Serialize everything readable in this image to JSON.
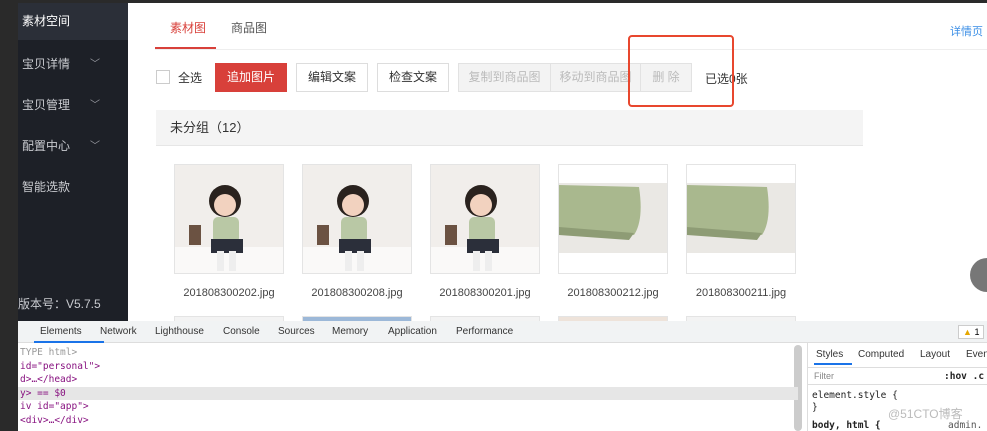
{
  "sidebar": {
    "items": [
      {
        "label": "素材空间",
        "active": true
      },
      {
        "label": "宝贝详情",
        "chevron": "chevron-down-icon"
      },
      {
        "label": "宝贝管理",
        "chevron": "chevron-down-icon"
      },
      {
        "label": "配置中心",
        "chevron": "chevron-down-icon"
      },
      {
        "label": "智能选款"
      }
    ],
    "version": "版本号：V5.7.5"
  },
  "tabs": [
    {
      "label": "素材图",
      "active": true
    },
    {
      "label": "商品图"
    }
  ],
  "top_right_link": "详情页",
  "toolbar": {
    "select_all": "全选",
    "add": "追加图片",
    "edit": "编辑文案",
    "check": "检查文案",
    "copy": "复制到商品图",
    "move": "移动到商品图",
    "delete": "删 除",
    "selected_count": "已选0张"
  },
  "group": {
    "title": "未分组（12）"
  },
  "images": [
    {
      "name": "201808300202.jpg",
      "kind": "child"
    },
    {
      "name": "201808300208.jpg",
      "kind": "child"
    },
    {
      "name": "201808300201.jpg",
      "kind": "child"
    },
    {
      "name": "201808300212.jpg",
      "kind": "fabric"
    },
    {
      "name": "201808300211.jpg",
      "kind": "fabric"
    }
  ],
  "devtools": {
    "tabs": [
      "Elements",
      "Network",
      "Lighthouse",
      "Console",
      "Sources",
      "Memory",
      "Application",
      "Performance"
    ],
    "warning_count": "1",
    "code": [
      "TYPE html>",
      "id=\"personal\">",
      "d>…</head>",
      "y> == $0",
      "iv id=\"app\">",
      "<div>…</div>"
    ],
    "styles_tabs": [
      "Styles",
      "Computed",
      "Layout",
      "Even"
    ],
    "filter_placeholder": "Filter",
    "hov": ":hov  .c",
    "rule1": "element.style {",
    "rule1_end": "}",
    "rule2": "body, html {",
    "rule2_src": "admin.",
    "watermark": "@51CTO博客"
  },
  "colors": {
    "accent": "#d8403a",
    "annotation": "#e8472e",
    "sidebar": "#1d2027"
  }
}
